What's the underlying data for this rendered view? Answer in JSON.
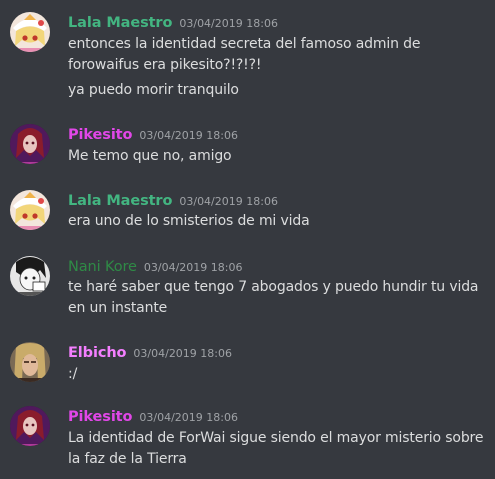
{
  "colors": {
    "background": "#36393f",
    "message_text": "#dcddde",
    "timestamp": "#9fa2a6",
    "green_role": "#43b581",
    "dark_green_role": "#2f8a46",
    "purple_role": "#e147e8",
    "pink_role": "#f47fff"
  },
  "messages": [
    {
      "author": "Lala Maestro",
      "timestamp": "03/04/2019 18:06",
      "avatar": "anime-girl-white-hat-avatar",
      "lines": [
        "entonces la identidad secreta del famoso admin de",
        "forowaifus era pikesito?!?!?!",
        "ya puedo morir tranquilo"
      ]
    },
    {
      "author": "Pikesito",
      "timestamp": "03/04/2019 18:06",
      "avatar": "dark-red-anime-avatar",
      "lines": [
        "Me temo que no, amigo"
      ]
    },
    {
      "author": "Lala Maestro",
      "timestamp": "03/04/2019 18:06",
      "avatar": "anime-girl-white-hat-avatar",
      "lines": [
        "era uno de lo smisterios de mi vida"
      ]
    },
    {
      "author": "Nani Kore",
      "timestamp": "03/04/2019 18:06",
      "avatar": "manga-monochrome-avatar",
      "lines": [
        "te haré saber que tengo 7 abogados y puedo hundir tu vida",
        "en un instante"
      ]
    },
    {
      "author": "Elbicho",
      "timestamp": "03/04/2019 18:06",
      "avatar": "blond-man-photo-avatar",
      "lines": [
        ":/"
      ]
    },
    {
      "author": "Pikesito",
      "timestamp": "03/04/2019 18:06",
      "avatar": "dark-red-anime-avatar",
      "lines": [
        "La identidad de ForWai sigue siendo el mayor misterio sobre",
        "la faz de la Tierra"
      ]
    }
  ]
}
